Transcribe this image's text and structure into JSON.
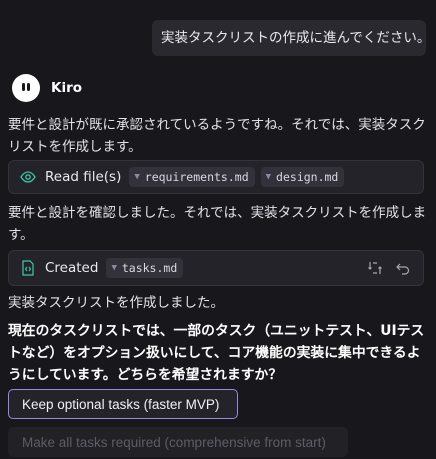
{
  "user_message": "実装タスクリストの作成に進んでください。",
  "agent": {
    "name": "Kiro"
  },
  "messages": {
    "p1": "要件と設計が既に承認されているようですね。それでは、実装タスクリストを作成します。",
    "p2": "要件と設計を確認しました。それでは、実装タスクリストを作成します。",
    "p3": "実装タスクリストを作成しました。",
    "p4": "現在のタスクリストでは、一部のタスク（ユニットテスト、UIテストなど）をオプション扱いにして、コア機能の実装に集中できるようにしています。どちらを希望されますか？"
  },
  "read_card": {
    "label": "Read file(s)",
    "icon": "eye-icon",
    "files": [
      "requirements.md",
      "design.md"
    ]
  },
  "created_card": {
    "label": "Created",
    "icon": "file-code-icon",
    "files": [
      "tasks.md"
    ],
    "actions": [
      "compare-icon",
      "undo-icon"
    ]
  },
  "buttons": {
    "keep_optional": "Keep optional tasks (faster MVP)",
    "make_required": "Make all tasks required (comprehensive from start)"
  },
  "colors": {
    "background": "#18171c",
    "accent": "#9b86e0",
    "eye_icon": "#3fc7a8"
  }
}
